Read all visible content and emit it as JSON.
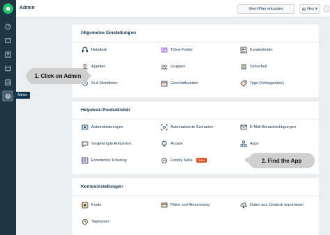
{
  "topbar": {
    "title": "Admin",
    "plan_button": "Ihren Plan erkunden",
    "new_button": "Neu"
  },
  "sidebar": {
    "tooltip": "Admin"
  },
  "sections": {
    "general": {
      "title": "Allgemeine Einstellungen",
      "items": [
        "Helpdesk",
        "Ticket-Felder",
        "Kundenfelder",
        "Agenten",
        "Gruppen",
        "Sicherheit",
        "SLA-Richtlinien",
        "Geschäftszeiten",
        "Tags (Schlagwörter)"
      ]
    },
    "productivity": {
      "title": "Helpdesk-Produktivität",
      "items": [
        "Automatisierungen",
        "Automatisierte Szenarien",
        "E-Mail-Benachrichtigungen",
        "Vorgefertigte Antworten",
        "Arcade",
        "Apps",
        "Erweitertes Ticketing",
        "Freddy Skills",
        ""
      ],
      "new_badge": "Neu"
    },
    "account": {
      "title": "Kontoeinstellungen",
      "items": [
        "Konto",
        "Pläne und Abrechnung",
        "Daten aus Zendesk importieren",
        "Tagespass"
      ]
    }
  },
  "callouts": {
    "step1": "1. Click on Admin",
    "step2": "2. Find the App"
  },
  "colors": {
    "sidebar_bg": "#1f3644",
    "logo_green": "#25c16f",
    "badge_orange": "#e8522a",
    "callout_gray": "#cfcfcf"
  }
}
